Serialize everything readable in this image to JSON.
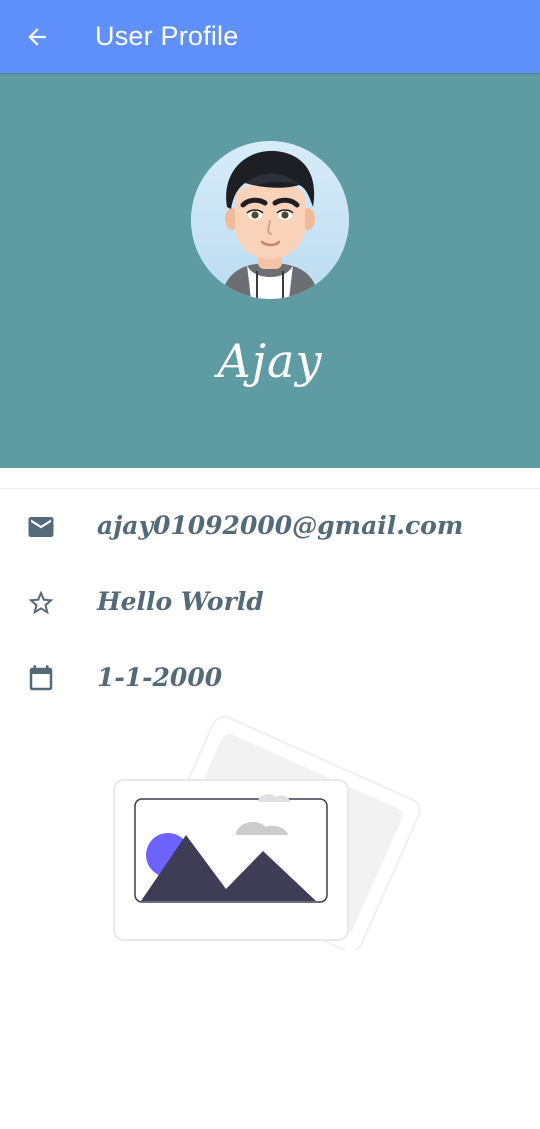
{
  "appbar": {
    "title": "User Profile",
    "back_icon": "arrow-left-icon",
    "background": "#6090fb"
  },
  "profile": {
    "name": "Ajay",
    "avatar": "avatar-image",
    "header_background": "#5f9ba3"
  },
  "details": [
    {
      "icon": "email-icon",
      "value": "ajay01092000@gmail.com"
    },
    {
      "icon": "star-outline-icon",
      "value": "Hello World"
    },
    {
      "icon": "calendar-icon",
      "value": "1-1-2000"
    }
  ],
  "illustration": {
    "icon": "image-placeholder-illustration",
    "accent": "#6c63ff",
    "mountain_color": "#3f3d56"
  },
  "colors": {
    "text": "#546a78",
    "icon": "#546a78"
  }
}
